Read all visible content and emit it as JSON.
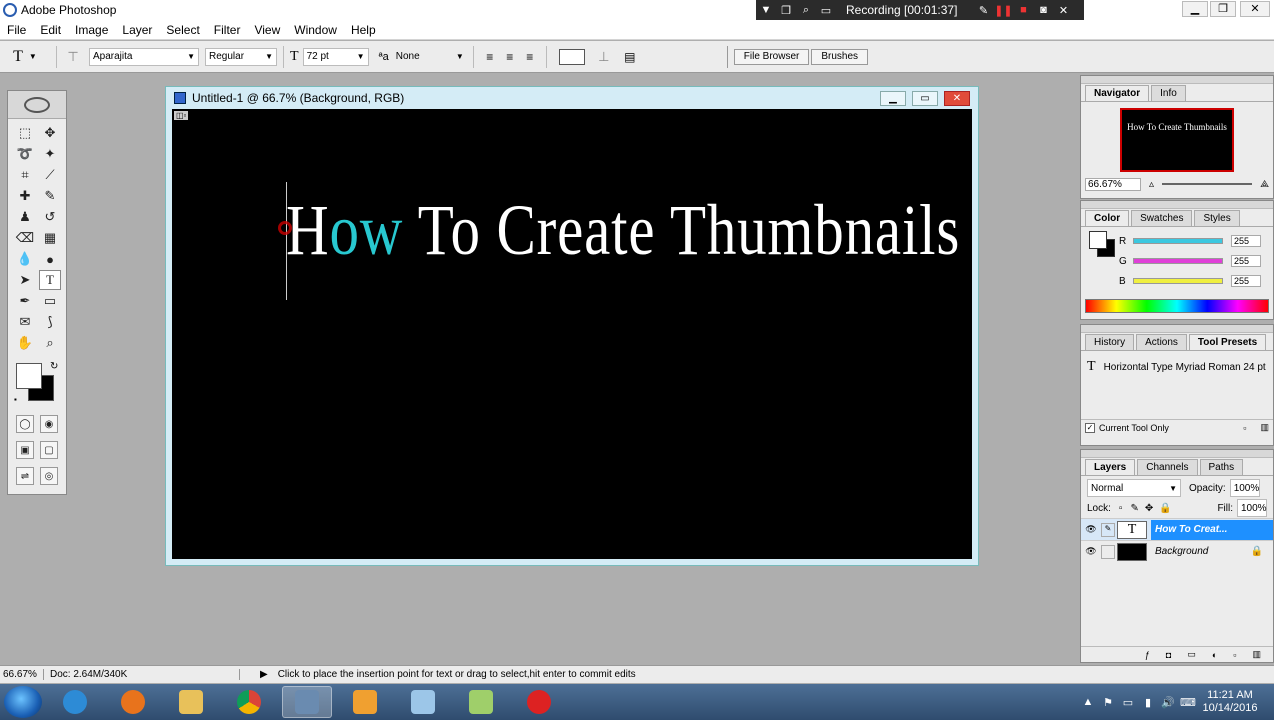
{
  "app": {
    "title": "Adobe Photoshop"
  },
  "recorder": {
    "status": "Recording [00:01:37]"
  },
  "menu": [
    "File",
    "Edit",
    "Image",
    "Layer",
    "Select",
    "Filter",
    "View",
    "Window",
    "Help"
  ],
  "options": {
    "font_family": "Aparajita",
    "font_style": "Regular",
    "font_size": "72 pt",
    "antialias": "None",
    "tab_file_browser": "File Browser",
    "tab_brushes": "Brushes"
  },
  "document": {
    "title": "Untitled-1 @ 66.7% (Background, RGB)",
    "text_prefix": "H",
    "text_highlight": "ow",
    "text_rest": " To Create Thumbnails"
  },
  "navigator": {
    "tabs": [
      "Navigator",
      "Info"
    ],
    "thumb_text": "How To Create Thumbnails",
    "zoom": "66.67%"
  },
  "color": {
    "tabs": [
      "Color",
      "Swatches",
      "Styles"
    ],
    "channels": [
      {
        "label": "R",
        "value": "255",
        "color": "#3cc8e0"
      },
      {
        "label": "G",
        "value": "255",
        "color": "#e040d8"
      },
      {
        "label": "B",
        "value": "255",
        "color": "#f0f040"
      }
    ]
  },
  "history": {
    "tabs": [
      "History",
      "Actions",
      "Tool Presets"
    ],
    "preset": "Horizontal Type Myriad Roman 24 pt",
    "current_tool_only": "Current Tool Only"
  },
  "layers": {
    "tabs": [
      "Layers",
      "Channels",
      "Paths"
    ],
    "blend": "Normal",
    "opacity_label": "Opacity:",
    "opacity": "100%",
    "lock_label": "Lock:",
    "fill_label": "Fill:",
    "fill": "100%",
    "items": [
      {
        "name": "How To Creat..."
      },
      {
        "name": "Background"
      }
    ]
  },
  "status": {
    "zoom": "66.67%",
    "doc": "Doc: 2.64M/340K",
    "hint": "Click to place the insertion point for text or drag to select,hit enter to commit edits"
  },
  "clock": {
    "time": "11:21 AM",
    "date": "10/14/2016"
  }
}
